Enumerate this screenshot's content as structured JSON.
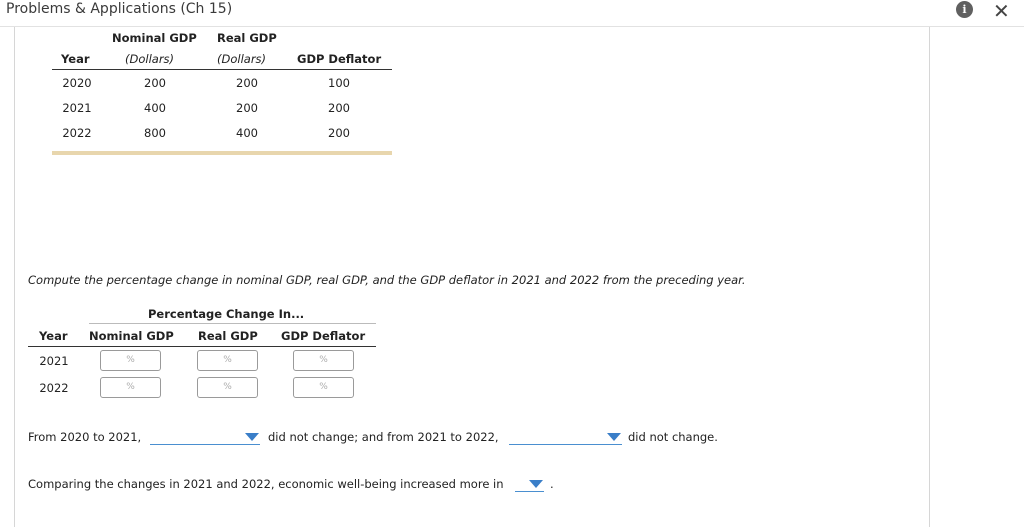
{
  "window": {
    "title": "Problems & Applications (Ch 15)",
    "info_icon": "i",
    "close_icon": "✕"
  },
  "data_table": {
    "headers": {
      "year": "Year",
      "nominal": "Nominal GDP",
      "nominal_unit": "(Dollars)",
      "real": "Real GDP",
      "real_unit": "(Dollars)",
      "deflator": "GDP Deflator"
    },
    "rows": [
      {
        "year": "2020",
        "nominal": "200",
        "real": "200",
        "deflator": "100"
      },
      {
        "year": "2021",
        "nominal": "400",
        "real": "200",
        "deflator": "200"
      },
      {
        "year": "2022",
        "nominal": "800",
        "real": "400",
        "deflator": "200"
      }
    ]
  },
  "instruction": "Compute the percentage change in nominal GDP, real GDP, and the GDP deflator in 2021 and 2022 from the preceding year.",
  "answer_table": {
    "group_header": "Percentage Change In...",
    "headers": {
      "year": "Year",
      "nominal": "Nominal GDP",
      "real": "Real GDP",
      "deflator": "GDP Deflator"
    },
    "rows": [
      {
        "year": "2021",
        "nominal_value": "",
        "real_value": "",
        "deflator_value": ""
      },
      {
        "year": "2022",
        "nominal_value": "",
        "real_value": "",
        "deflator_value": ""
      }
    ],
    "pct_symbol": "%"
  },
  "sentence1": {
    "part1": "From 2020 to 2021,",
    "part2": "did not change; and from 2021 to 2022,",
    "part3": "did not change.",
    "dropdown1_value": "",
    "dropdown2_value": ""
  },
  "sentence2": {
    "part1": "Comparing the changes in 2021 and 2022, economic well-being increased more in",
    "part2": ".",
    "dropdown_value": ""
  },
  "colors": {
    "dropdown_accent": "#3a7ec8",
    "table_rule": "#333333",
    "table_bottom_rule": "#e8d6ad"
  }
}
